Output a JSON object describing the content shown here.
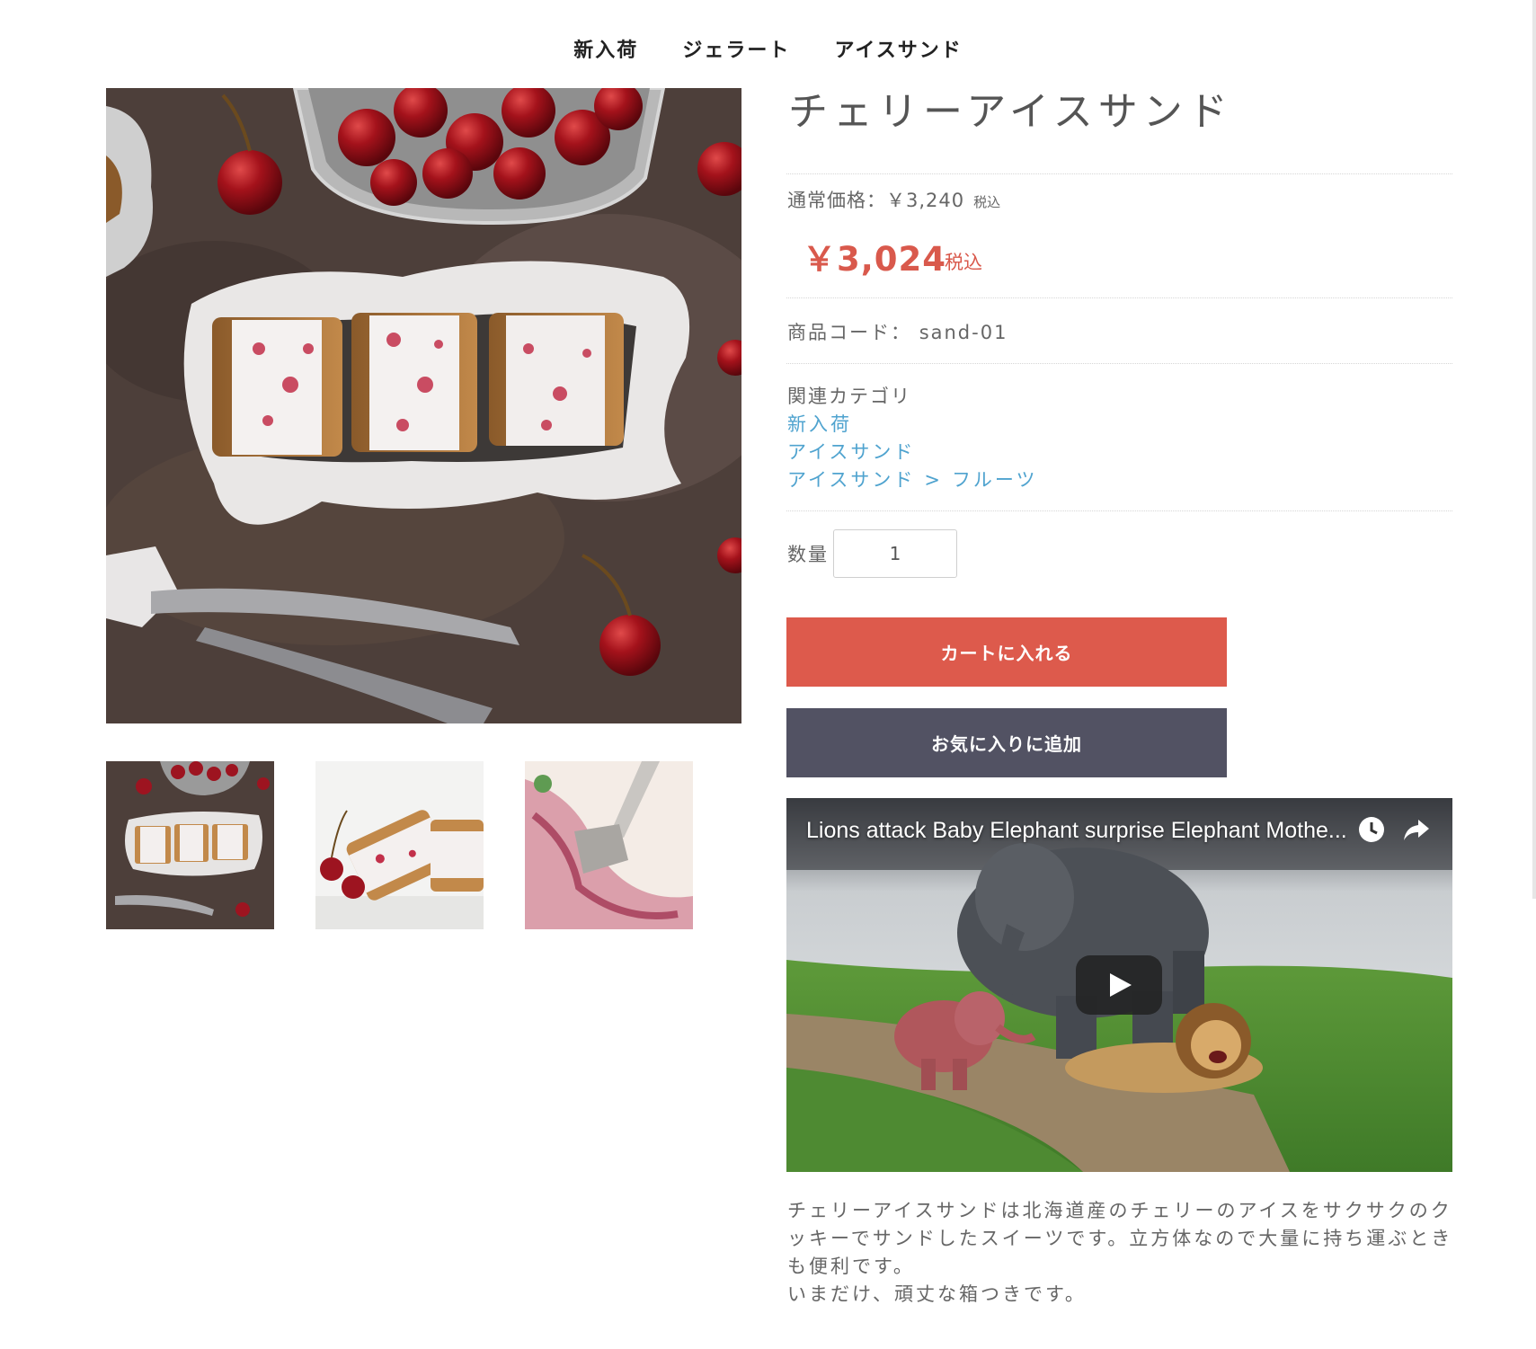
{
  "nav": {
    "items": [
      "新入荷",
      "ジェラート",
      "アイスサンド"
    ]
  },
  "product": {
    "title": "チェリーアイスサンド",
    "regular_price_label": "通常価格：￥3,240",
    "regular_price_tax": "税込",
    "sale_price": "￥3,024",
    "sale_price_tax": "税込",
    "code_label": "商品コード：",
    "code": "sand-01",
    "category_label": "関連カテゴリ",
    "categories": [
      {
        "parts": [
          "新入荷"
        ]
      },
      {
        "parts": [
          "アイスサンド"
        ]
      },
      {
        "parts": [
          "アイスサンド",
          "フルーツ"
        ]
      }
    ],
    "category_separator": ">",
    "quantity_label": "数量",
    "quantity_value": "1",
    "add_to_cart_label": "カートに入れる",
    "add_to_favorites_label": "お気に入りに追加",
    "description_lines": [
      "チェリーアイスサンドは北海道産のチェリーのアイスをサクサクのクッキーでサンドしたスイーツです。立方体なので大量に持ち運ぶときも便利です。",
      "いまだけ、頑丈な箱つきです。"
    ]
  },
  "video": {
    "title": "Lions attack Baby Elephant surprise Elephant Mothe...",
    "icons": [
      "clock-icon",
      "share-icon",
      "play-icon"
    ]
  },
  "colors": {
    "sale_price": "#d9594c",
    "link": "#4fa3cf",
    "cart_button": "#dd5a4c",
    "favorite_button": "#525263"
  }
}
